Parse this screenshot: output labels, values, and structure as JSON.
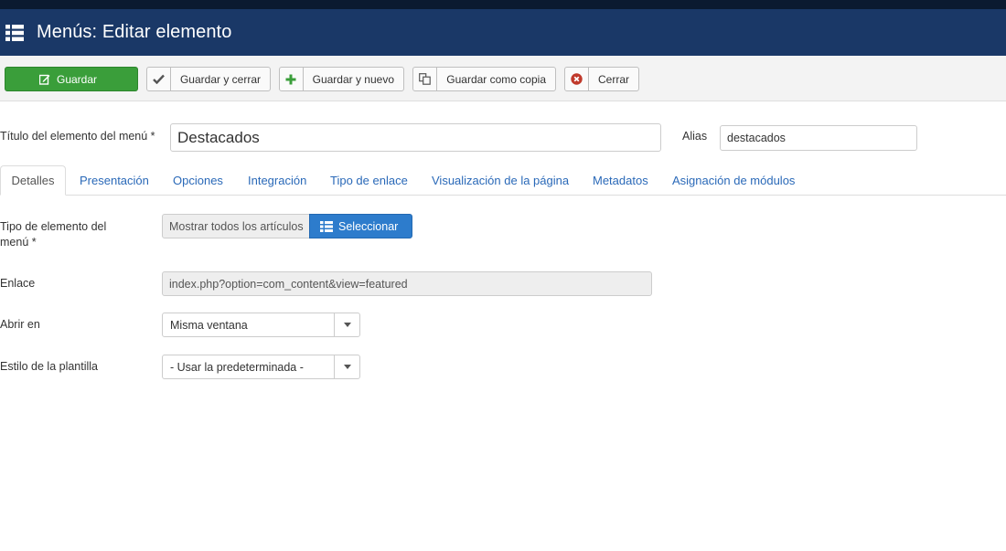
{
  "header": {
    "title": "Menús: Editar elemento"
  },
  "toolbar": {
    "save": "Guardar",
    "save_close": "Guardar y cerrar",
    "save_new": "Guardar y nuevo",
    "save_copy": "Guardar como copia",
    "close": "Cerrar"
  },
  "form": {
    "title_label": "Título del elemento del menú *",
    "title_value": "Destacados",
    "alias_label": "Alias",
    "alias_value": "destacados"
  },
  "tabs": [
    "Detalles",
    "Presentación",
    "Opciones",
    "Integración",
    "Tipo de enlace",
    "Visualización de la página",
    "Metadatos",
    "Asignación de módulos"
  ],
  "details": {
    "menu_type_label_line1": "Tipo de elemento del",
    "menu_type_label_line2": "menú *",
    "menu_type_value": "Mostrar todos los artículos",
    "select_button": "Seleccionar",
    "link_label": "Enlace",
    "link_value": "index.php?option=com_content&view=featured",
    "open_in_label": "Abrir en",
    "open_in_value": "Misma ventana",
    "template_style_label": "Estilo de la plantilla",
    "template_style_value": "- Usar la predeterminada -"
  },
  "colors": {
    "header_bg": "#1a3867",
    "save_green": "#3a9e3a",
    "link_blue": "#2a69b8",
    "select_button_blue": "#2d7ccc"
  },
  "icons": {
    "header": "list-icon",
    "save": "edit-icon",
    "save_close": "check-icon",
    "save_new": "plus-icon",
    "save_copy": "copy-icon",
    "close": "close-circle-icon",
    "select": "list-icon",
    "dropdown": "caret-down-icon"
  }
}
